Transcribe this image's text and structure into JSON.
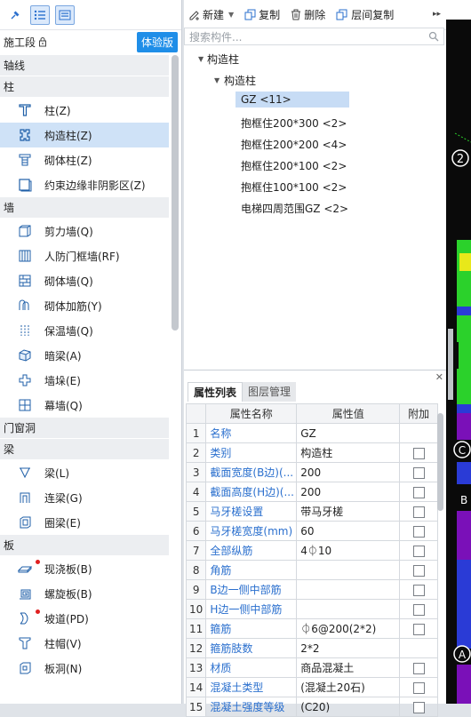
{
  "left_panel": {
    "stage_label": "施工段",
    "trial_button": "体验版",
    "categories": [
      {
        "label": "轴线",
        "items": []
      },
      {
        "label": "柱",
        "items": [
          {
            "label": "柱(Z)",
            "icon": "column-icon"
          },
          {
            "label": "构造柱(Z)",
            "icon": "construction-column-icon"
          },
          {
            "label": "砌体柱(Z)",
            "icon": "masonry-column-icon"
          },
          {
            "label": "约束边缘非阴影区(Z)",
            "icon": "constraint-edge-icon"
          }
        ]
      },
      {
        "label": "墙",
        "items": [
          {
            "label": "剪力墙(Q)",
            "icon": "shear-wall-icon"
          },
          {
            "label": "人防门框墙(RF)",
            "icon": "civil-defense-wall-icon"
          },
          {
            "label": "砌体墙(Q)",
            "icon": "masonry-wall-icon"
          },
          {
            "label": "砌体加筋(Y)",
            "icon": "masonry-reinforcement-icon"
          },
          {
            "label": "保温墙(Q)",
            "icon": "insulation-wall-icon"
          },
          {
            "label": "暗梁(A)",
            "icon": "hidden-beam-icon"
          },
          {
            "label": "墙垛(E)",
            "icon": "wall-pier-icon"
          },
          {
            "label": "幕墙(Q)",
            "icon": "curtain-wall-icon"
          }
        ]
      },
      {
        "label": "门窗洞",
        "items": []
      },
      {
        "label": "梁",
        "items": [
          {
            "label": "梁(L)",
            "icon": "beam-icon"
          },
          {
            "label": "连梁(G)",
            "icon": "coupling-beam-icon"
          },
          {
            "label": "圈梁(E)",
            "icon": "ring-beam-icon"
          }
        ]
      },
      {
        "label": "板",
        "items": [
          {
            "label": "现浇板(B)",
            "icon": "cast-slab-icon"
          },
          {
            "label": "螺旋板(B)",
            "icon": "spiral-slab-icon"
          },
          {
            "label": "坡道(PD)",
            "icon": "ramp-icon"
          },
          {
            "label": "柱帽(V)",
            "icon": "column-cap-icon"
          },
          {
            "label": "板洞(N)",
            "icon": "slab-hole-icon"
          }
        ]
      }
    ]
  },
  "toolbar": {
    "new_label": "新建",
    "copy_label": "复制",
    "delete_label": "删除",
    "floor_copy_label": "层间复制"
  },
  "search": {
    "placeholder": "搜索构件..."
  },
  "component_tree": {
    "root": "构造柱",
    "group": "构造柱",
    "selected": "GZ <11>",
    "items": [
      "抱框住200*300 <2>",
      "抱框住200*200 <4>",
      "抱框住200*100 <2>",
      "抱框住100*100 <2>",
      "电梯四周范围GZ <2>"
    ]
  },
  "properties": {
    "tabs": [
      "属性列表",
      "图层管理"
    ],
    "headers": [
      "属性名称",
      "属性值",
      "附加"
    ],
    "rows": [
      {
        "num": "1",
        "name": "名称",
        "value": "GZ",
        "checkbox": false
      },
      {
        "num": "2",
        "name": "类别",
        "value": "构造柱",
        "checkbox": true
      },
      {
        "num": "3",
        "name": "截面宽度(B边)(...",
        "value": "200",
        "checkbox": true
      },
      {
        "num": "4",
        "name": "截面高度(H边)(...",
        "value": "200",
        "checkbox": true
      },
      {
        "num": "5",
        "name": "马牙槎设置",
        "value": "带马牙槎",
        "checkbox": true
      },
      {
        "num": "6",
        "name": "马牙槎宽度(mm)",
        "value": "60",
        "checkbox": true
      },
      {
        "num": "7",
        "name": "全部纵筋",
        "value": "4⏀10",
        "checkbox": true
      },
      {
        "num": "8",
        "name": "角筋",
        "value": "",
        "checkbox": true
      },
      {
        "num": "9",
        "name": "B边一侧中部筋",
        "value": "",
        "checkbox": true
      },
      {
        "num": "10",
        "name": "H边一侧中部筋",
        "value": "",
        "checkbox": true
      },
      {
        "num": "11",
        "name": "箍筋",
        "value": "⏀6@200(2*2)",
        "checkbox": true
      },
      {
        "num": "12",
        "name": "箍筋肢数",
        "value": "2*2",
        "checkbox": false
      },
      {
        "num": "13",
        "name": "材质",
        "value": "商品混凝土",
        "checkbox": true
      },
      {
        "num": "14",
        "name": "混凝土类型",
        "value": "(混凝土20石)",
        "checkbox": true
      },
      {
        "num": "15",
        "name": "混凝土强度等级",
        "value": "(C20)",
        "checkbox": true
      }
    ]
  },
  "canvas": {
    "labels": [
      "2",
      "C",
      "B",
      "A"
    ],
    "colors": {
      "green": "#2bd12b",
      "yellow": "#e8e81a",
      "purple": "#7a10b8",
      "blue": "#2a3bd6",
      "dark": "#0a0a0a"
    }
  }
}
